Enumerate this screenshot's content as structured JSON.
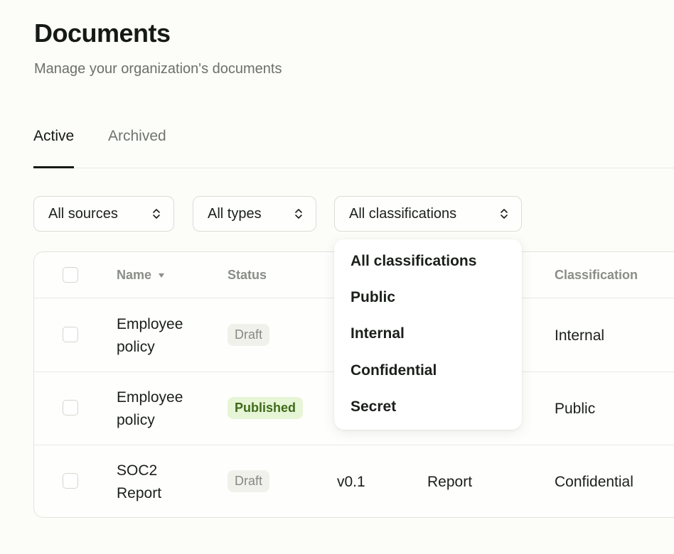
{
  "header": {
    "title": "Documents",
    "subtitle": "Manage your organization's documents"
  },
  "tabs": [
    {
      "label": "Active",
      "active": true
    },
    {
      "label": "Archived",
      "active": false
    }
  ],
  "filters": {
    "sources": "All sources",
    "types": "All types",
    "classifications": "All classifications"
  },
  "table": {
    "columns": {
      "name": "Name",
      "status": "Status",
      "classification": "Classification"
    },
    "rows": [
      {
        "name_line1": "Employee",
        "name_line2": "policy",
        "status": "Draft",
        "version": "",
        "type": "",
        "classification": "Internal"
      },
      {
        "name_line1": "Employee",
        "name_line2": "policy",
        "status": "Published",
        "version": "",
        "type": "",
        "classification": "Public"
      },
      {
        "name_line1": "SOC2",
        "name_line2": "Report",
        "status": "Draft",
        "version": "v0.1",
        "type": "Report",
        "classification": "Confidential"
      }
    ]
  },
  "dropdown": {
    "options": [
      "All classifications",
      "Public",
      "Internal",
      "Confidential",
      "Secret"
    ]
  },
  "colors": {
    "background": "#fcfcf9",
    "published_badge_bg": "#e6f5d6",
    "published_badge_text": "#3f6b1a",
    "draft_badge_bg": "#f1f1ec"
  }
}
